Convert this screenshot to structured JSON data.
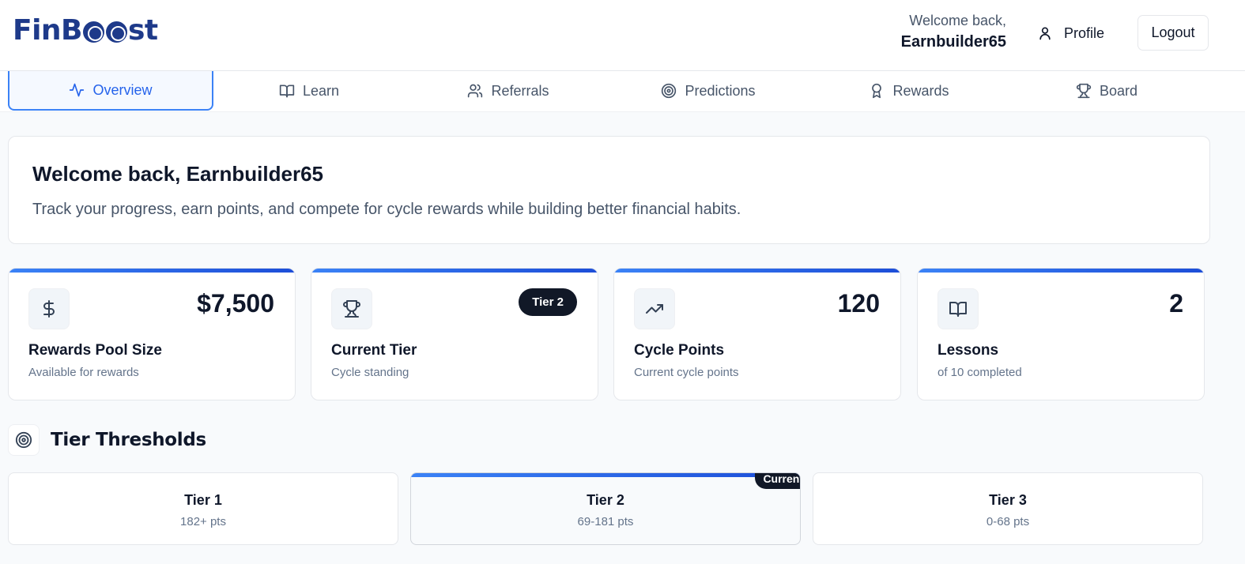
{
  "header": {
    "logo": "FinBoost",
    "welcome_line1": "Welcome back,",
    "welcome_user": "Earnbuilder65",
    "profile_label": "Profile",
    "logout_label": "Logout"
  },
  "tabs": [
    {
      "label": "Overview",
      "icon": "activity-icon",
      "active": true
    },
    {
      "label": "Learn",
      "icon": "book-open-icon"
    },
    {
      "label": "Referrals",
      "icon": "users-icon"
    },
    {
      "label": "Predictions",
      "icon": "target-icon"
    },
    {
      "label": "Rewards",
      "icon": "award-icon"
    },
    {
      "label": "Board",
      "icon": "trophy-icon"
    }
  ],
  "welcome_card": {
    "title": "Welcome back, Earnbuilder65",
    "subtitle": "Track your progress, earn points, and compete for cycle rewards while building better financial habits."
  },
  "stats": [
    {
      "icon": "dollar-icon",
      "value": "$7,500",
      "label": "Rewards Pool Size",
      "sub": "Available for rewards"
    },
    {
      "icon": "trophy-icon",
      "badge": "Tier 2",
      "label": "Current Tier",
      "sub": "Cycle standing"
    },
    {
      "icon": "trending-up-icon",
      "value": "120",
      "label": "Cycle Points",
      "sub": "Current cycle points"
    },
    {
      "icon": "book-open-icon",
      "value": "2",
      "label": "Lessons",
      "sub": "of 10 completed"
    }
  ],
  "tier_section": {
    "title": "Tier Thresholds",
    "tiers": [
      {
        "name": "Tier 1",
        "range": "182+ pts"
      },
      {
        "name": "Tier 2",
        "range": "69-181 pts",
        "current": true,
        "badge": "Current"
      },
      {
        "name": "Tier 3",
        "range": "0-68 pts"
      }
    ]
  },
  "colors": {
    "accent": "#3b82f6",
    "brand": "#1e3a8a",
    "dark": "#111827"
  }
}
